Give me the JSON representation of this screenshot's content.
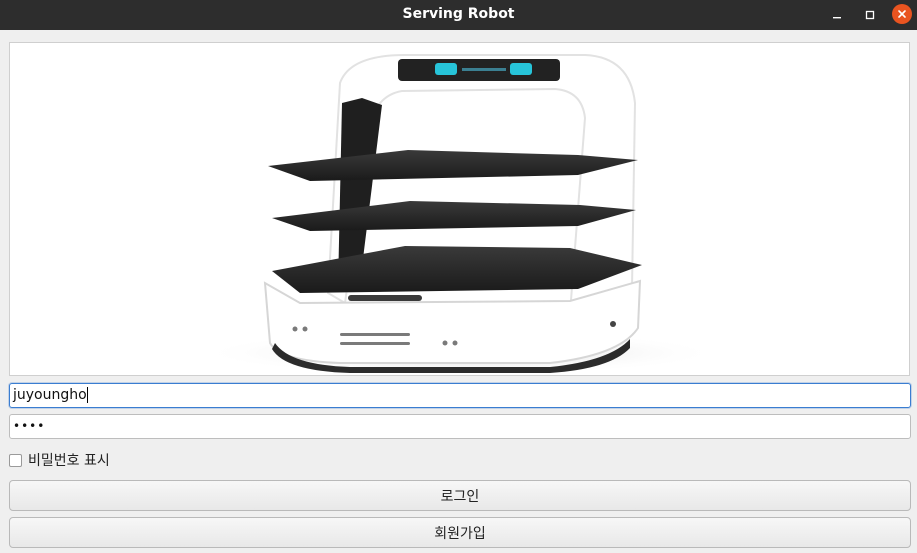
{
  "window": {
    "title": "Serving Robot"
  },
  "login": {
    "username_value": "juyoungho",
    "password_masked": "••••",
    "show_password_label": "비밀번호 표시",
    "show_password_checked": false,
    "login_button_label": "로그인",
    "signup_button_label": "회원가입"
  },
  "icons": {
    "minimize": "minimize-icon",
    "maximize": "maximize-icon",
    "close": "close-icon",
    "robot_image": "serving-robot-image"
  },
  "colors": {
    "titlebar": "#2d2d2d",
    "close_button": "#e95420",
    "focus_border": "#3a7dd1"
  }
}
